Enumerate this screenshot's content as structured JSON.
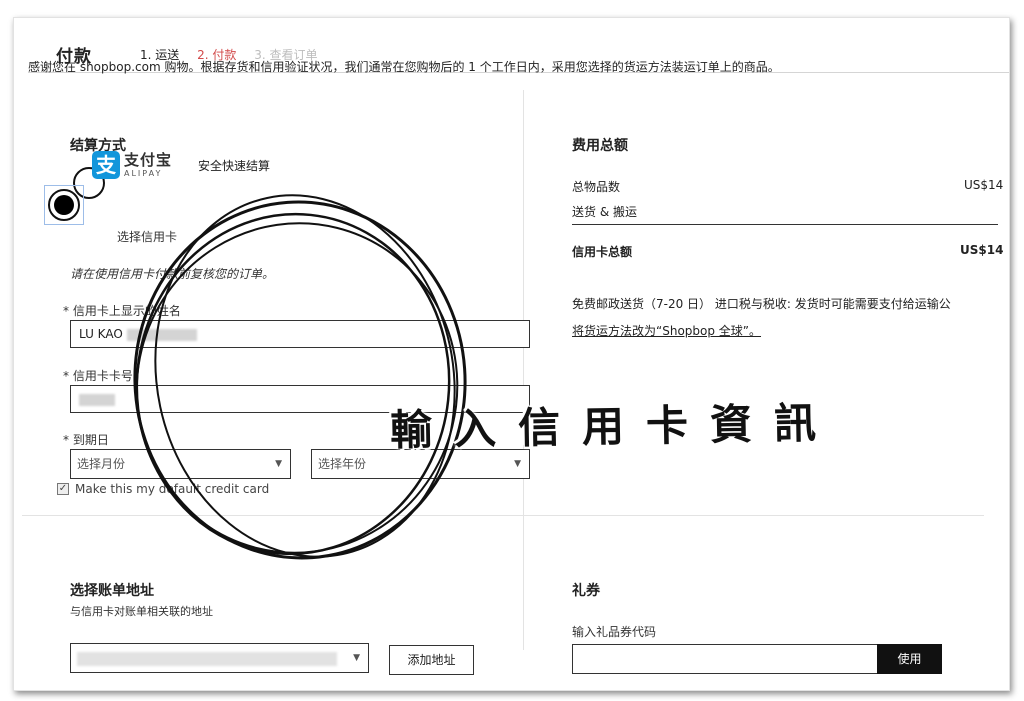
{
  "header": {
    "title": "付款",
    "steps": [
      "1. 运送",
      "2. 付款",
      "3. 查看订单"
    ]
  },
  "intro": "感谢您在 shopbop.com 购物。根据存货和信用验证状况，我们通常在您购物后的 1 个工作日内，采用您选择的货运方法装运订单上的商品。",
  "payment": {
    "title": "结算方式",
    "alipay_cn": "支付宝",
    "alipay_en": "ALIPAY",
    "alipay_desc": "安全快速结算",
    "credit_label": "选择信用卡",
    "hint": "请在使用信用卡付款前复核您的订单。",
    "name_label": "* 信用卡上显示的姓名",
    "name_value": "LU KAO",
    "number_label": "* 信用卡卡号",
    "expiry_label": "* 到期日",
    "month_placeholder": "选择月份",
    "year_placeholder": "选择年份",
    "default_card_label": "Make this my default credit card"
  },
  "summary": {
    "title": "费用总额",
    "items_label": "总物品数",
    "items_value": "US$14",
    "shipping_label": "送货 & 搬运",
    "total_label": "信用卡总额",
    "total_value": "US$14",
    "note": "免费邮政送货（7-20 日） 进口税与税收: 发货时可能需要支付给运输公",
    "change_link": "将货运方法改为“Shopbop 全球”。"
  },
  "billing": {
    "title": "选择账单地址",
    "subtitle": "与信用卡对账单相关联的地址",
    "add_button": "添加地址"
  },
  "coupon": {
    "title": "礼券",
    "label": "输入礼品券代码",
    "apply_button": "使用"
  },
  "overlay_caption": "輸入信用卡資訊"
}
